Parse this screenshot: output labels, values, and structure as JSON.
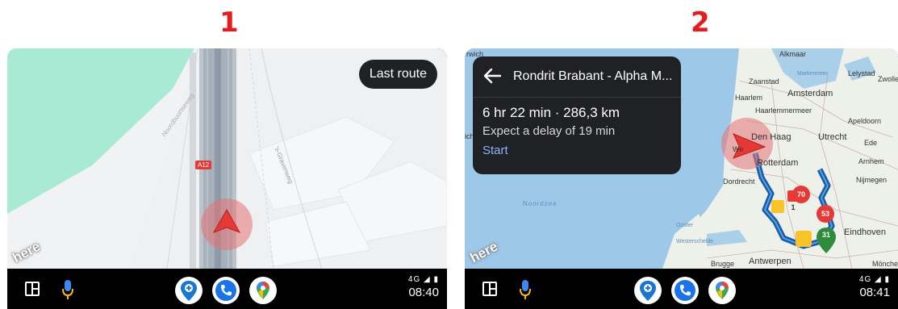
{
  "panels": [
    {
      "step_label": "1",
      "map": {
        "road_ref": "A12",
        "street_labels": [
          "Noordbuurtseweg",
          "'s-Gravenweg"
        ],
        "last_route_label": "Last route",
        "brand": "here"
      },
      "taskbar": {
        "signal": "4G",
        "clock": "08:40"
      }
    },
    {
      "step_label": "2",
      "route_card": {
        "title": "Rondrit Brabant - Alpha M...",
        "duration_distance": "6 hr 22 min · 286,3 km",
        "delay": "Expect a delay of 19 min",
        "start_label": "Start"
      },
      "map": {
        "brand": "here",
        "sea_label": "Noordzee",
        "cities": [
          "Alkmaar",
          "Lelystad",
          "Zwolle",
          "Zaanstad",
          "Amsterdam",
          "Haarlem",
          "Haarlemmermeer",
          "Apeldoorn",
          "Den Haag",
          "Utrecht",
          "Ede",
          "Arnhem",
          "Rotterdam",
          "Nijmegen",
          "Dordrecht",
          "Eindhoven",
          "Brugge",
          "Antwerpen",
          "Mönche",
          "rwich",
          "We",
          "ich",
          "Markermeer",
          "Ooster",
          "Westerschelde"
        ],
        "markers": [
          "70",
          "53",
          "31",
          "1"
        ]
      },
      "taskbar": {
        "signal": "4G",
        "clock": "08:41"
      }
    }
  ],
  "colors": {
    "step_label": "#e31d1d",
    "accent_blue": "#8ab4f8",
    "route": "#1b5aa7",
    "position_marker": "#e53935"
  }
}
